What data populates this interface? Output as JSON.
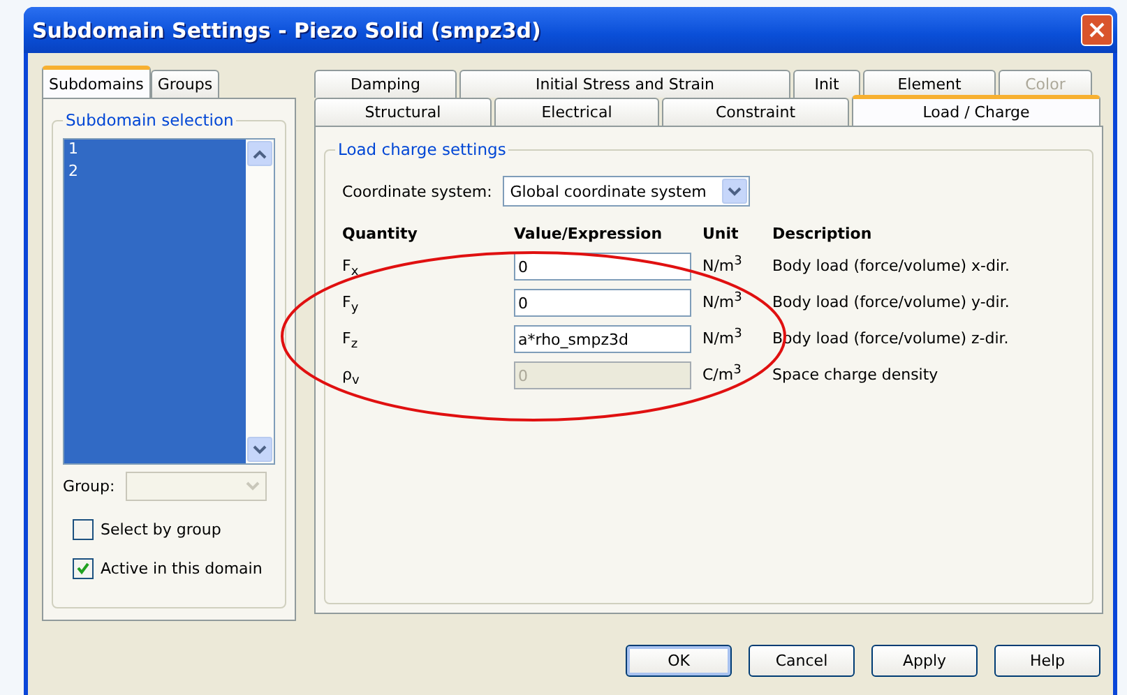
{
  "window": {
    "title": "Subdomain Settings - Piezo Solid (smpz3d)"
  },
  "left_tabs": [
    {
      "label": "Subdomains",
      "selected": true
    },
    {
      "label": "Groups",
      "selected": false
    }
  ],
  "subdomain_selection": {
    "title": "Subdomain selection",
    "items": [
      {
        "label": "1",
        "selected": true
      },
      {
        "label": "2",
        "selected": true
      }
    ],
    "group_label": "Group:",
    "group_disabled": true,
    "checkboxes": [
      {
        "label": "Select by group",
        "checked": false
      },
      {
        "label": "Active in this domain",
        "checked": true
      }
    ]
  },
  "tab_rows": [
    [
      {
        "label": "Damping",
        "selected": false,
        "disabled": false
      },
      {
        "label": "Initial Stress and Strain",
        "selected": false,
        "disabled": false
      },
      {
        "label": "Init",
        "selected": false,
        "disabled": false
      },
      {
        "label": "Element",
        "selected": false,
        "disabled": false
      },
      {
        "label": "Color",
        "selected": false,
        "disabled": true
      }
    ],
    [
      {
        "label": "Structural",
        "selected": false,
        "disabled": false
      },
      {
        "label": "Electrical",
        "selected": false,
        "disabled": false
      },
      {
        "label": "Constraint",
        "selected": false,
        "disabled": false
      },
      {
        "label": "Load / Charge",
        "selected": true,
        "disabled": false
      }
    ]
  ],
  "settings": {
    "title": "Load charge settings",
    "coordinate_label": "Coordinate system:",
    "coordinate_value": "Global coordinate system",
    "columns": [
      "Quantity",
      "Value/Expression",
      "Unit",
      "Description"
    ],
    "rows": [
      {
        "quantity": "F$_{x}$",
        "value": "0",
        "unit": "N/m$^{3}$",
        "description": "Body load (force/volume) x-dir.",
        "disabled": false
      },
      {
        "quantity": "F$_{y}$",
        "value": "0",
        "unit": "N/m$^{3}$",
        "description": "Body load (force/volume) y-dir.",
        "disabled": false
      },
      {
        "quantity": "F$_{z}$",
        "value": "a*rho_smpz3d",
        "unit": "N/m$^{3}$",
        "description": "Body load (force/volume) z-dir.",
        "disabled": false
      },
      {
        "quantity": "ρ$_{v}$",
        "value": "0",
        "unit": "C/m$^{3}$",
        "description": "Space charge density",
        "disabled": true
      }
    ]
  },
  "buttons": [
    {
      "label": "OK",
      "default": true
    },
    {
      "label": "Cancel",
      "default": false
    },
    {
      "label": "Apply",
      "default": false
    },
    {
      "label": "Help",
      "default": false
    }
  ]
}
